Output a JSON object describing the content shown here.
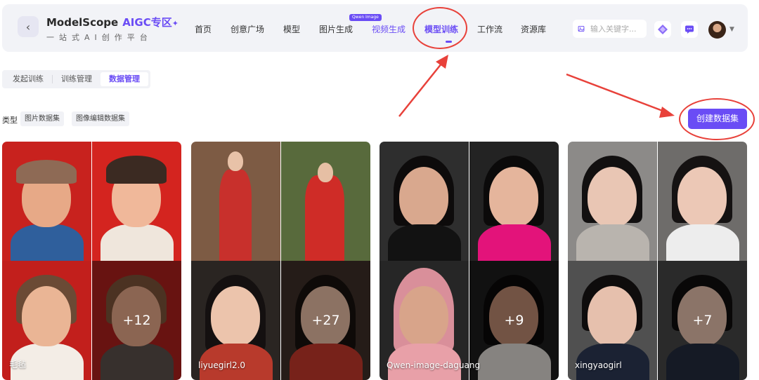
{
  "brand": {
    "name": "ModelScope",
    "aigc": "AIGC专区",
    "spark": "✦",
    "subtitle": "一站式AI创作平台"
  },
  "nav": {
    "items": [
      "首页",
      "创意广场",
      "模型",
      "图片生成",
      "视频生成",
      "模型训练",
      "工作流",
      "资源库"
    ],
    "badge": "Qwen Image",
    "active": "模型训练"
  },
  "search": {
    "placeholder": "输入关键字..."
  },
  "subtabs": [
    "发起训练",
    "训练管理",
    "数据管理"
  ],
  "filters": {
    "label": "类型",
    "chips": [
      "图片数据集",
      "图像编辑数据集"
    ]
  },
  "create_button": "创建数据集",
  "cards": [
    {
      "name": "毛毡",
      "count": "+12"
    },
    {
      "name": "liyuegirl2.0",
      "count": "+27"
    },
    {
      "name": "Qwen-image-daguang",
      "count": "+9"
    },
    {
      "name": "xingyaogirl",
      "count": "+7"
    }
  ],
  "colors": {
    "accent": "#6a4cf5",
    "annotation": "#e8413a"
  }
}
